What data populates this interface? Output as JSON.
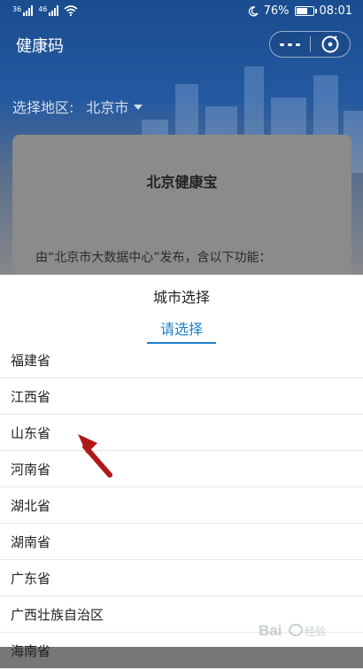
{
  "status": {
    "signal_tag_1": "36",
    "signal_tag_2": "46",
    "battery": "76%",
    "time": "08:01"
  },
  "header": {
    "title": "健康码"
  },
  "region": {
    "label": "选择地区:",
    "value": "北京市"
  },
  "card": {
    "title": "北京健康宝",
    "description": "由“北京市大数据中心”发布，含以下功能："
  },
  "sheet": {
    "title": "城市选择",
    "tab": "请选择",
    "options": [
      {
        "label": "福建省"
      },
      {
        "label": "江西省"
      },
      {
        "label": "山东省"
      },
      {
        "label": "河南省"
      },
      {
        "label": "湖北省"
      },
      {
        "label": "湖南省"
      },
      {
        "label": "广东省"
      },
      {
        "label": "广西壮族自治区"
      },
      {
        "label": "海南省"
      }
    ]
  },
  "battery_level": 0.76,
  "colors": {
    "accent": "#1a7fd0",
    "header_blue": "#1a4d8f",
    "annotation_arrow": "#b01818"
  },
  "icons": {
    "more": "more-dots-icon",
    "close": "close-circle-icon",
    "caret": "caret-down-icon",
    "wifi": "wifi-icon",
    "moon": "moon-icon",
    "battery": "battery-icon",
    "arrow": "red-arrow-annotation-icon"
  }
}
